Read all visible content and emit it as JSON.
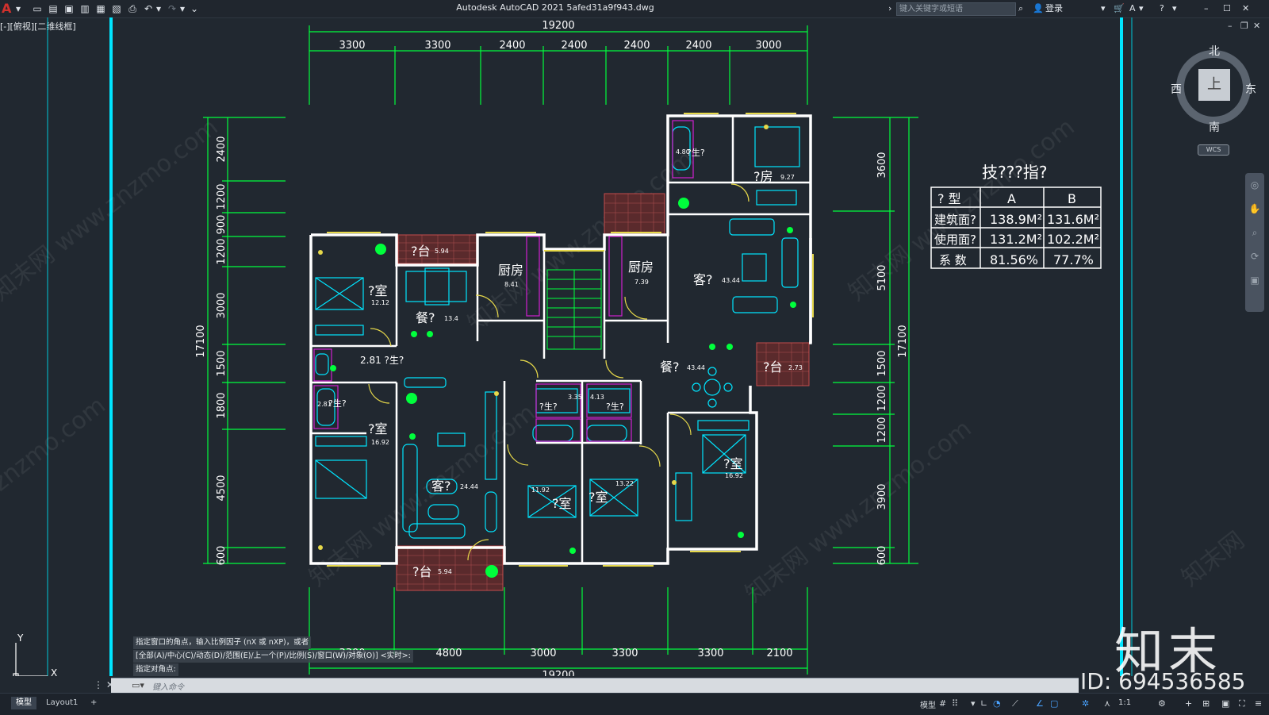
{
  "app": {
    "logo": "A",
    "title": "Autodesk AutoCAD 2021    5afed31a9f943.dwg",
    "search_placeholder": "键入关键字或短语",
    "login": "登录",
    "viewport_label": "[-][俯视][二维线框]"
  },
  "drawing": {
    "top_total": "19200",
    "top_dims": [
      "3300",
      "3300",
      "2400",
      "2400",
      "2400",
      "2400",
      "3000"
    ],
    "bottom_total": "19200",
    "bottom_dims": [
      "3300",
      "4800",
      "3000",
      "3300",
      "3300",
      "2100"
    ],
    "left_total": "17100",
    "left_dims": [
      "2400",
      "1200",
      "900",
      "1200",
      "3000",
      "1500",
      "1800",
      "4500",
      "600"
    ],
    "right_total": "17100",
    "right_dims": [
      "3600",
      "5100",
      "1500",
      "1200",
      "1200",
      "3900",
      "600"
    ],
    "rooms": [
      {
        "name": "?台",
        "area": "5.94"
      },
      {
        "name": "厨房",
        "area": "8.41"
      },
      {
        "name": "厨房",
        "area": "7.39"
      },
      {
        "name": "?室",
        "area": "12.12"
      },
      {
        "name": "餐?",
        "area": "13.4"
      },
      {
        "name": "2.81 ?生?",
        "area": ""
      },
      {
        "name": "?室",
        "area": "16.92"
      },
      {
        "name": "客?",
        "area": "24.44"
      },
      {
        "name": "?室",
        "area": "11.92"
      },
      {
        "name": "?室",
        "area": "13.22"
      },
      {
        "name": "?台",
        "area": "5.94"
      },
      {
        "name": "?房",
        "area": "9.27"
      },
      {
        "name": "客?",
        "area": "43.44"
      },
      {
        "name": "餐?",
        "area": "43.44"
      },
      {
        "name": "?台",
        "area": "2.73"
      },
      {
        "name": "?室",
        "area": "16.92"
      },
      {
        "name": "?生?",
        "area": "4.80"
      },
      {
        "name": "?生?",
        "area": "3.35"
      },
      {
        "name": "?生?",
        "area": "4.13"
      },
      {
        "name": "?生?",
        "area": "2.81"
      }
    ],
    "table": {
      "title": "技???指?",
      "headers": [
        "? 型",
        "A",
        "B"
      ],
      "rows": [
        [
          "建筑面?",
          "138.9M²",
          "131.6M²"
        ],
        [
          "使用面?",
          "131.2M²",
          "102.2M²"
        ],
        [
          "系  数",
          "81.56%",
          "77.7%"
        ]
      ]
    },
    "axis": {
      "x": "X",
      "y": "Y"
    }
  },
  "viewcube": {
    "north": "北",
    "south": "南",
    "east": "东",
    "west": "西",
    "top": "上",
    "wcs": "WCS"
  },
  "command": {
    "history": [
      "指定窗口的角点，输入比例因子 (nX 或 nXP)，或者",
      "[全部(A)/中心(C)/动态(D)/范围(E)/上一个(P)/比例(S)/窗口(W)/对象(O)] <实时>:",
      "指定对角点:"
    ],
    "placeholder": "键入命令"
  },
  "status": {
    "tabs": [
      "模型",
      "Layout1",
      "+"
    ],
    "model": "模型",
    "scale": "1:1"
  },
  "watermark": {
    "logo": "知末",
    "id": "ID: 694536585"
  },
  "colors": {
    "background": "#212830",
    "cyan": "#00e5ff",
    "green": "#00ff3c",
    "white": "#ffffff",
    "magenta": "#d020d0",
    "brick": "#b04a4a"
  }
}
